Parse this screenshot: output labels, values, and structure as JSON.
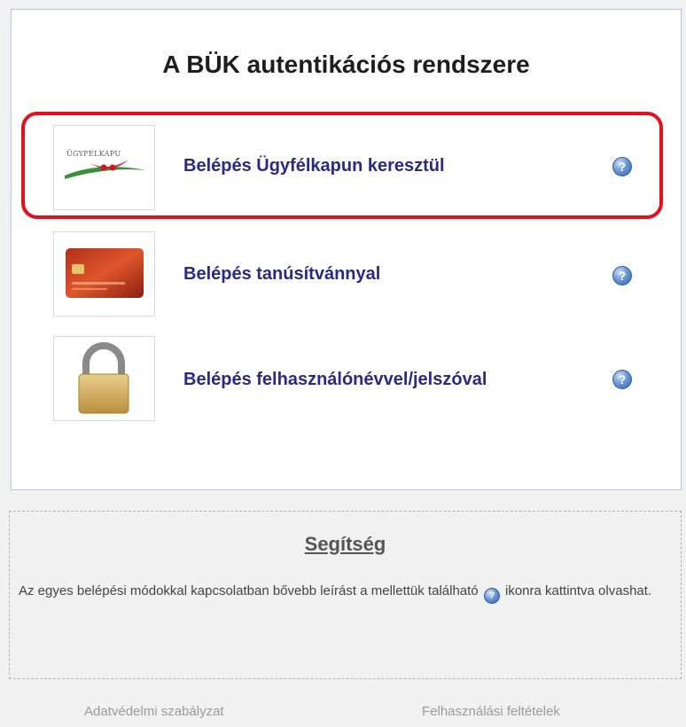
{
  "panel": {
    "title": "A BÜK autentikációs rendszere",
    "methods": [
      {
        "label": "Belépés Ügyfélkapun keresztül",
        "icon": "ugyfelkapu-logo",
        "help_icon": "?"
      },
      {
        "label": "Belépés tanúsítvánnyal",
        "icon": "certificate-card-icon",
        "help_icon": "?"
      },
      {
        "label": "Belépés felhasználónévvel/jelszóval",
        "icon": "padlock-icon",
        "help_icon": "?"
      }
    ],
    "logo_text": "ÜGYFÉLKAPU",
    "highlight_color": "#e4111d"
  },
  "help": {
    "title": "Segítség",
    "text_before": "Az egyes belépési módokkal kapcsolatban bővebb leírást a mellettük található",
    "text_after": "ikonra kattintva olvashat.",
    "inline_icon": "?"
  },
  "footer": {
    "privacy": "Adatvédelmi szabályzat",
    "terms": "Felhasználási feltételek"
  }
}
